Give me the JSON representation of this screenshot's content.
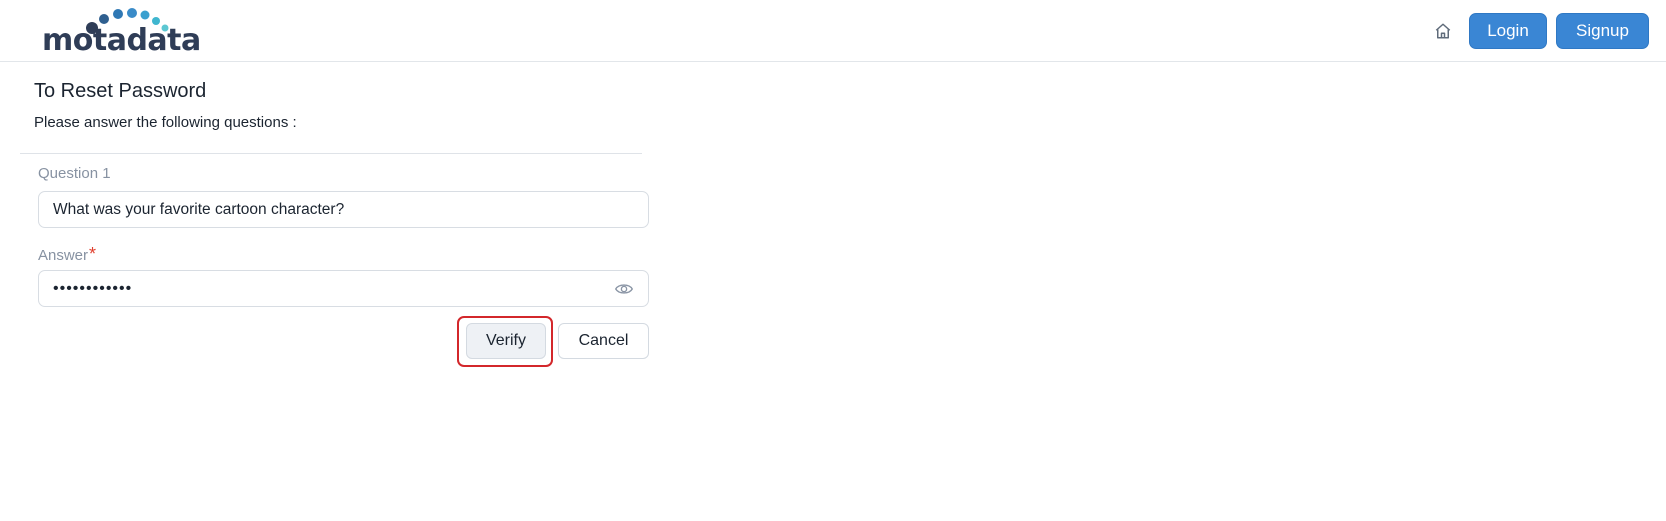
{
  "header": {
    "logo_text": "motadata",
    "home_icon": "home-icon",
    "login_label": "Login",
    "signup_label": "Signup"
  },
  "form": {
    "title": "To Reset Password",
    "subtitle": "Please answer the following questions :",
    "question_label": "Question 1",
    "question_value": "What was your favorite cartoon character?",
    "answer_label": "Answer",
    "answer_required_mark": "*",
    "answer_masked_value": "••••••••••••",
    "eye_icon": "eye-icon",
    "verify_label": "Verify",
    "cancel_label": "Cancel"
  },
  "colors": {
    "primary": "#3a86d4",
    "logo_dark": "#2f3d57",
    "logo_accent": "#3aa6c9",
    "required": "#e0402f",
    "highlight_ring": "#d3272b"
  }
}
